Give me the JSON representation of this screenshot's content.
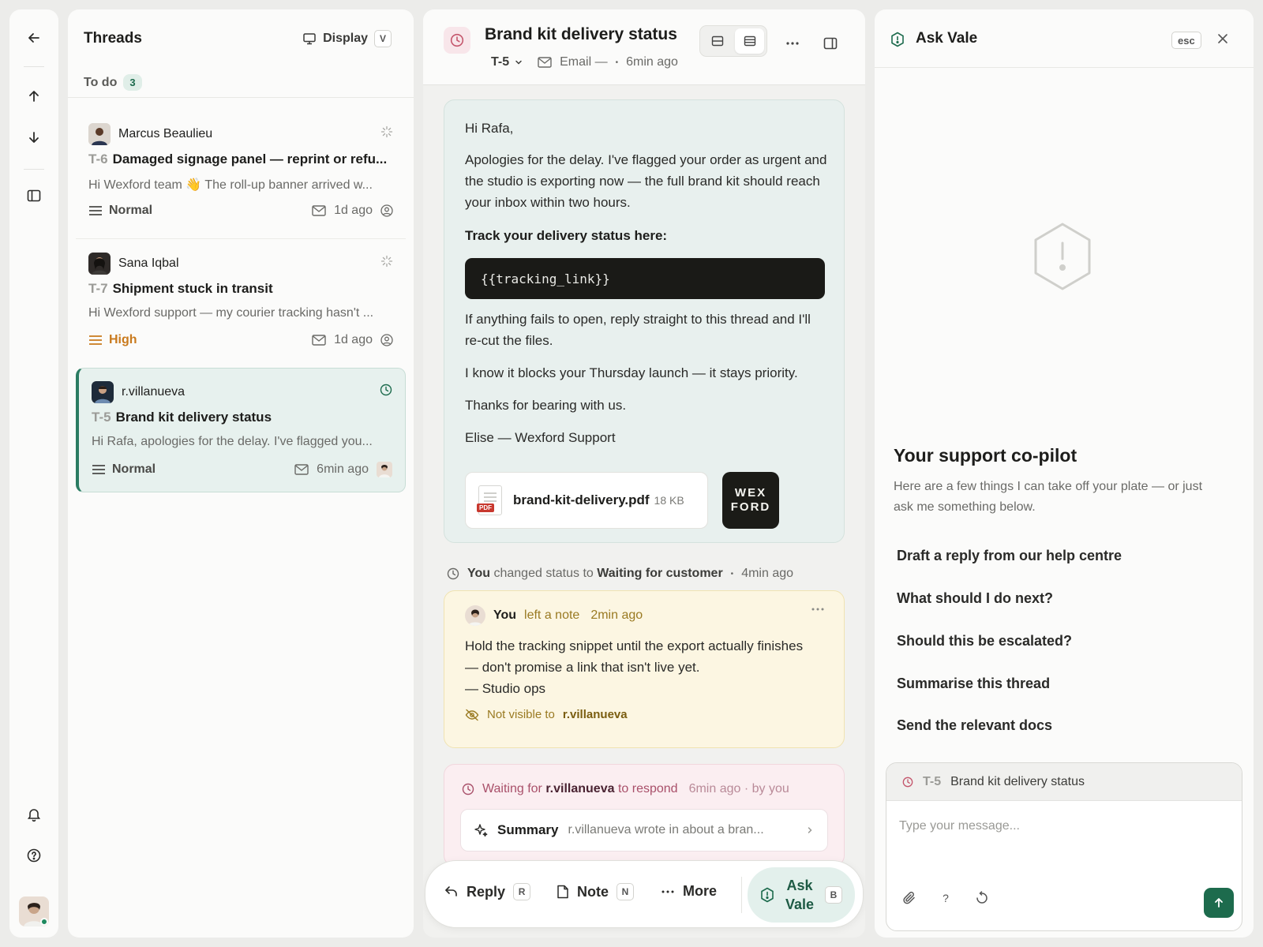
{
  "threads": {
    "title": "Threads",
    "display_label": "Display",
    "display_key": "V",
    "todo_label": "To do",
    "todo_count": "3",
    "items": [
      {
        "user": "Marcus Beaulieu",
        "id": "T-6",
        "subject": "Damaged signage panel — reprint or refu...",
        "preview": "Hi Wexford team 👋 The roll-up banner arrived w...",
        "priority": "Normal",
        "time": "1d ago"
      },
      {
        "user": "Sana Iqbal",
        "id": "T-7",
        "subject": "Shipment stuck in transit",
        "preview": "Hi Wexford support — my courier tracking hasn't ...",
        "priority": "High",
        "time": "1d ago"
      },
      {
        "user": "r.villanueva",
        "id": "T-5",
        "subject": "Brand kit delivery status",
        "preview": "Hi Rafa, apologies for the delay. I've flagged you...",
        "priority": "Normal",
        "time": "6min ago"
      }
    ]
  },
  "conversation": {
    "title": "Brand kit delivery status",
    "ticket": "T-5",
    "channel": "Email —",
    "time": "6min ago",
    "email": {
      "greeting": "Hi Rafa,",
      "para1": "Apologies for the delay. I've flagged your order as urgent and the studio is exporting now — the full brand kit should reach your inbox within two hours.",
      "track_heading": "Track your delivery status here:",
      "code": "{{tracking_link}}",
      "para2": "If anything fails to open, reply straight to this thread and I'll re-cut the files.",
      "para3": "I know it blocks your Thursday launch — it stays priority.",
      "para4": "Thanks for bearing with us.",
      "signature": "Elise — Wexford Support",
      "attachment_name": "brand-kit-delivery.pdf",
      "attachment_size": "18 KB",
      "attachment_tag": "PDF",
      "logo_line1": "WEX",
      "logo_line2": "FORD"
    },
    "activity": {
      "actor": "You",
      "text": "changed status to",
      "status": "Waiting for customer",
      "bullet": "•",
      "time": "4min ago"
    },
    "note": {
      "author": "You",
      "action": "left a note",
      "time": "2min ago",
      "line1": "Hold the tracking snippet until the export actually finishes — don't promise a link that isn't live yet.",
      "line2": "— Studio ops",
      "visibility_label": "Not visible to",
      "visibility_user": "r.villanueva"
    },
    "waiting": {
      "prefix": "Waiting for",
      "user": "r.villanueva",
      "suffix": "to respond",
      "time": "6min ago · by you",
      "summary_label": "Summary",
      "summary_text": "r.villanueva wrote in about a bran..."
    },
    "actions": {
      "reply": "Reply",
      "reply_key": "R",
      "note": "Note",
      "note_key": "N",
      "more": "More",
      "ask_line1": "Ask",
      "ask_line2": "Vale",
      "ask_key": "B"
    }
  },
  "vale": {
    "title": "Ask Vale",
    "esc": "esc",
    "copilot_title": "Your support co-pilot",
    "copilot_desc": "Here are a few things I can take off your plate — or just ask me something below.",
    "suggestions": [
      "Draft a reply from our help centre",
      "What should I do next?",
      "Should this be escalated?",
      "Summarise this thread",
      "Send the relevant docs"
    ],
    "context_id": "T-5",
    "context_title": "Brand kit delivery status",
    "placeholder": "Type your message...",
    "help_glyph": "?"
  },
  "colors": {
    "accent": "#1d6b4d",
    "high_priority": "#c97a1d",
    "waiting": "#c4566c",
    "note_bg": "#fcf6e2"
  }
}
